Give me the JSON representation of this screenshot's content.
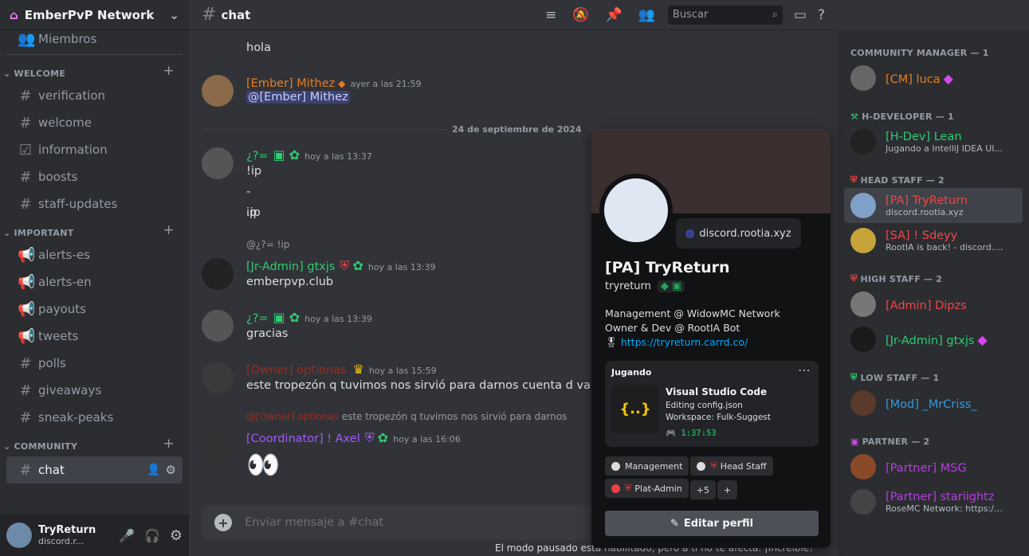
{
  "server": {
    "name": "EmberPvP Network"
  },
  "sidebar": {
    "top": "Miembros",
    "cat1": "WELCOME",
    "cat1_items": [
      "verification",
      "welcome",
      "information",
      "boosts",
      "staff-updates"
    ],
    "cat2": "IMPORTANT",
    "cat2_items": [
      "alerts-es",
      "alerts-en",
      "payouts",
      "tweets",
      "polls",
      "giveaways",
      "sneak-peaks"
    ],
    "cat3": "COMMUNITY",
    "selected": "chat"
  },
  "user": {
    "name": "TryReturn",
    "status": "discord.r..."
  },
  "header": {
    "channel": "chat",
    "search": "Buscar"
  },
  "messages": [
    {
      "text": "hola"
    },
    {
      "name": "[Ember] Mithez",
      "time": "ayer a las 21:59",
      "text": "@[Ember] Mithez",
      "color": "#e67e22"
    },
    {
      "divider": "24 de septiembre de 2024"
    },
    {
      "name": "¿?=",
      "time": "hoy a las 13:37",
      "lines": [
        "!ip",
        "-ip",
        ".ip"
      ],
      "color": "#2ecc71"
    },
    {
      "reply": "@¿?= !ip",
      "name": "[Jr-Admin] gtxjs",
      "time": "hoy a las 13:39",
      "text": "emberpvp.club",
      "color": "#2ecc71"
    },
    {
      "name": "¿?=",
      "time": "hoy a las 13:39",
      "text": "gracias",
      "color": "#2ecc71"
    },
    {
      "name": "[Owner] optionas",
      "time": "hoy a las 15:59",
      "text": "este tropezón q tuvimos nos sirvió para darnos cuenta d varias c",
      "color": "#992d22"
    },
    {
      "reply": "@[Owner] optionas",
      "reply_text": "este tropezón q tuvimos nos sirvió para darnos",
      "name": "[Coordinator] ! Axel",
      "time": "hoy a las 16:06",
      "text": "👀",
      "color": "#a259ff"
    }
  ],
  "composer": {
    "placeholder": "Enviar mensaje a #chat"
  },
  "footer": "El modo pausado está habilitado, pero a ti no te afecta. ¡Increíble!",
  "popout": {
    "display_name": "[PA] TryReturn",
    "username": "tryreturn",
    "custom_status": "discord.rootia.xyz",
    "bio": [
      "Management @ WidowMC Network",
      "Owner & Dev @ RootIA Bot"
    ],
    "link": "https://tryreturn.carrd.co/",
    "activity_header": "Jugando",
    "app": "Visual Studio Code",
    "details": "Editing config.json",
    "state": "Workspace: Fulk-Suggest",
    "elapsed": "1:37:53",
    "roles": [
      "Management",
      "Head Staff",
      "Plat-Admin"
    ],
    "roles_more": "+5",
    "edit": "Editar perfil"
  },
  "members": [
    {
      "cat": "COMMUNITY MANAGER — 1",
      "items": [
        {
          "name": "[CM] luca",
          "color": "#e67e22"
        }
      ]
    },
    {
      "cat": "H-DEVELOPER — 1",
      "items": [
        {
          "name": "[H-Dev] Lean",
          "color": "#2ecc71",
          "sub": "Jugando a IntelliJ IDEA Ul..."
        }
      ]
    },
    {
      "cat": "HEAD STAFF — 2",
      "items": [
        {
          "name": "[PA] TryReturn",
          "color": "#f04747",
          "sub": "discord.rootia.xyz"
        },
        {
          "name": "[SA] ! Sdeyy",
          "color": "#f04747",
          "sub": "RootIA is back! - discord.r..."
        }
      ]
    },
    {
      "cat": "HIGH STAFF — 2",
      "items": [
        {
          "name": "[Admin] Dipzs",
          "color": "#f04747"
        },
        {
          "name": "[Jr-Admin] gtxjs",
          "color": "#2ecc71"
        }
      ]
    },
    {
      "cat": "LOW STAFF — 1",
      "items": [
        {
          "name": "[Mod] _MrCriss_",
          "color": "#3498db"
        }
      ]
    },
    {
      "cat": "PARTNER — 2",
      "items": [
        {
          "name": "[Partner] MSG",
          "color": "#b93de0"
        },
        {
          "name": "[Partner] stariightz",
          "color": "#b93de0",
          "sub": "RoseMC Network: https://..."
        }
      ]
    }
  ]
}
